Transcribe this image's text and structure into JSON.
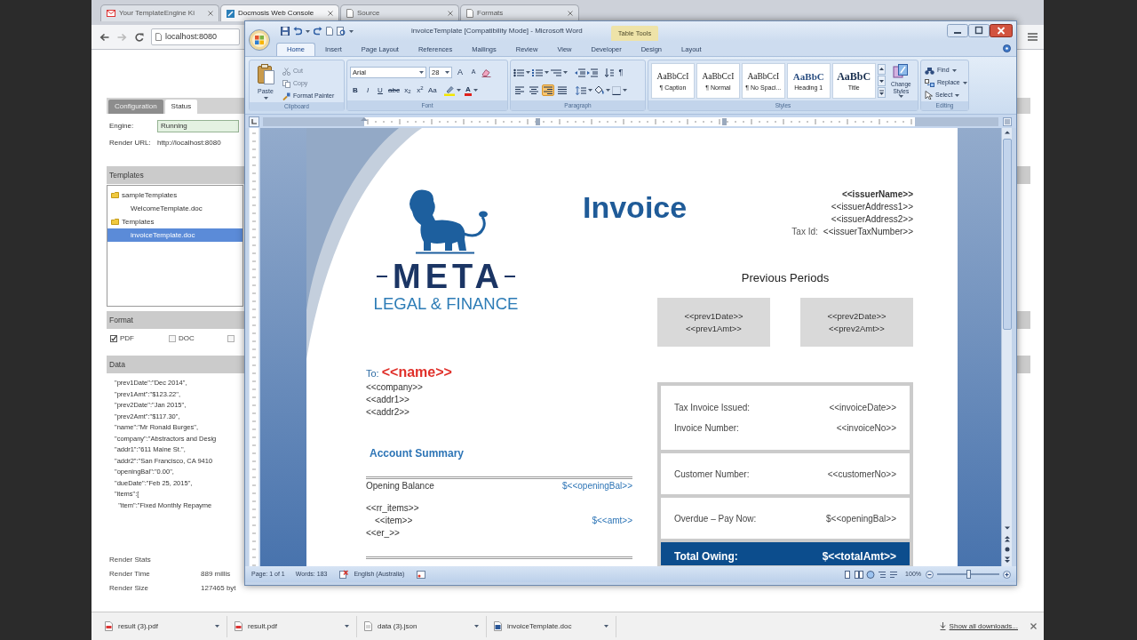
{
  "browser": {
    "tabs": [
      {
        "label": "Your TemplateEngine Ki",
        "kind": "mail",
        "selected": false
      },
      {
        "label": "Docmosis Web Console",
        "kind": "app",
        "selected": true
      },
      {
        "label": "Source",
        "kind": "page",
        "selected": false
      },
      {
        "label": "Formats",
        "kind": "page",
        "selected": false
      }
    ],
    "address": "localhost:8080"
  },
  "console": {
    "tabs": [
      {
        "label": "Configuration",
        "selected": false
      },
      {
        "label": "Status",
        "selected": true
      }
    ],
    "engine": {
      "label": "Engine:",
      "value": "Running"
    },
    "render_url": {
      "label": "Render URL:",
      "value": "http://localhost:8080"
    },
    "templates": {
      "title": "Templates",
      "tree": [
        {
          "label": "sampleTemplates",
          "kind": "folder",
          "selected": false,
          "children": [
            {
              "label": "WelcomeTemplate.doc",
              "kind": "file",
              "selected": false
            }
          ]
        },
        {
          "label": "Templates",
          "kind": "folder",
          "selected": false,
          "children": [
            {
              "label": "invoiceTemplate.doc",
              "kind": "file",
              "selected": true
            }
          ]
        }
      ]
    },
    "format": {
      "title": "Format",
      "options": [
        {
          "label": "PDF",
          "checked": true
        },
        {
          "label": "DOC",
          "checked": false
        },
        {
          "checked": false
        }
      ]
    },
    "data": {
      "title": "Data",
      "lines": [
        "\"prev1Date\":\"Dec 2014\",",
        "\"prev1Amt\":\"$123.22\",",
        "\"prev2Date\":\"Jan 2015\",",
        "\"prev2Amt\":\"$117.30\",",
        "\"name\":\"Mr Ronald Burges\",",
        "\"company\":\"Abstractors and Desig",
        "\"addr1\":\"611 Maine St.\",",
        "\"addr2\":\"San Francisco, CA 9410",
        "\"openingBal\":\"0.00\",",
        "\"dueDate\":\"Feb 25, 2015\",",
        "\"items\":[",
        "  \"item\":\"Fixed Monthly Repayme"
      ]
    },
    "stats": {
      "title": "Render Stats",
      "rows": [
        {
          "label": "Render Time",
          "value": "889 millis"
        },
        {
          "label": "Render Size",
          "value": "127465 byt"
        }
      ]
    }
  },
  "word": {
    "title": "invoiceTemplate [Compatibility Mode] - Microsoft Word",
    "contextual_tab": "Table Tools",
    "tabs": [
      {
        "label": "Home",
        "selected": true
      },
      {
        "label": "Insert",
        "selected": false
      },
      {
        "label": "Page Layout",
        "selected": false
      },
      {
        "label": "References",
        "selected": false
      },
      {
        "label": "Mailings",
        "selected": false
      },
      {
        "label": "Review",
        "selected": false
      },
      {
        "label": "View",
        "selected": false
      },
      {
        "label": "Developer",
        "selected": false
      },
      {
        "label": "Design",
        "selected": false
      },
      {
        "label": "Layout",
        "selected": false
      }
    ],
    "clipboard": {
      "title": "Clipboard",
      "paste": "Paste",
      "commands": [
        {
          "kind": "cut",
          "label": "Cut",
          "disabled": true
        },
        {
          "kind": "copy",
          "label": "Copy",
          "disabled": true
        },
        {
          "kind": "painter",
          "label": "Format Painter",
          "disabled": false
        }
      ]
    },
    "font": {
      "title": "Font",
      "face": "Arial",
      "size": "28",
      "size_buttons": [
        "A",
        "A"
      ],
      "style_buttons": [
        {
          "kind": "bold",
          "glyph": "B"
        },
        {
          "kind": "italic",
          "glyph": "I"
        },
        {
          "kind": "underline",
          "glyph": "U"
        },
        {
          "kind": "strike",
          "glyph": "abc"
        },
        {
          "kind": "plain",
          "glyph": "x$_{2}$"
        },
        {
          "kind": "plain",
          "glyph": "x$^{2}$"
        },
        {
          "kind": "plain",
          "glyph": "Aa"
        }
      ],
      "color_glyph": "A"
    },
    "paragraph": {
      "title": "Paragraph",
      "marks_glyph": "¶",
      "alignment": [
        {
          "kind": "left",
          "selected": false
        },
        {
          "kind": "center",
          "selected": false
        },
        {
          "kind": "right",
          "selected": true
        },
        {
          "kind": "justify",
          "selected": false
        }
      ]
    },
    "styles": {
      "title": "Styles",
      "gallery": [
        {
          "sample": "AaBbCcI",
          "name": "¶ Caption",
          "kind": "body",
          "selected": false
        },
        {
          "sample": "AaBbCcI",
          "name": "¶ Normal",
          "kind": "body",
          "selected": false
        },
        {
          "sample": "AaBbCcI",
          "name": "¶ No Spaci...",
          "kind": "body",
          "selected": false
        },
        {
          "sample": "AaBbC",
          "name": "Heading 1",
          "kind": "heading",
          "selected": false
        },
        {
          "sample": "AaBbC",
          "name": "Title",
          "kind": "title",
          "selected": false
        }
      ],
      "change_styles": "Change Styles"
    },
    "editing": {
      "title": "Editing",
      "commands": [
        {
          "kind": "find",
          "label": "Find"
        },
        {
          "kind": "replace",
          "label": "Replace"
        },
        {
          "kind": "select",
          "label": "Select"
        }
      ]
    },
    "document": {
      "logo": {
        "name": "META",
        "tagline": "LEGAL & FINANCE"
      },
      "title": "Invoice",
      "issuer": {
        "name": "<<issuerName>>",
        "address_lines": [
          "<<issuerAddress1>>",
          "<<issuerAddress2>>"
        ],
        "tax_label": "Tax Id:",
        "tax_value": "<<issuerTaxNumber>>"
      },
      "previous_periods": {
        "title": "Previous Periods",
        "periods": [
          {
            "date": "<<prev1Date>>",
            "amount": "<<prev1Amt>>"
          },
          {
            "date": "<<prev2Date>>",
            "amount": "<<prev2Amt>>"
          }
        ]
      },
      "recipient": {
        "to_label": "To:",
        "name": "<<name>>",
        "lines": [
          "<<company>>",
          "<<addr1>>",
          "<<addr2>>"
        ]
      },
      "account_summary": {
        "title": "Account Summary",
        "rows": [
          {
            "kind": "balance",
            "label": "Opening Balance",
            "value": "$<<openingBal>>"
          },
          {
            "kind": "marker",
            "label": "<<rr_items>>"
          },
          {
            "kind": "item",
            "label": "<<item>>",
            "value": "$<<amt>>"
          },
          {
            "kind": "marker",
            "label": "<<er_>>"
          }
        ]
      },
      "summary_panels": [
        {
          "kind": "plain",
          "rows": [
            {
              "label": "Tax Invoice Issued:",
              "value": "<<invoiceDate>>"
            },
            {
              "label": "Invoice Number:",
              "value": "<<invoiceNo>>"
            }
          ]
        },
        {
          "kind": "plain",
          "rows": [
            {
              "label": "Customer Number:",
              "value": "<<customerNo>>"
            }
          ]
        },
        {
          "kind": "plain",
          "rows": [
            {
              "label": "Overdue – Pay Now:",
              "value": "$<<openingBal>>"
            }
          ]
        },
        {
          "kind": "total",
          "rows": [
            {
              "label": "Total Owing:",
              "value": "$<<totalAmt>>"
            }
          ]
        }
      ]
    },
    "status_bar": {
      "page": "Page: 1 of 1",
      "words": "Words: 183",
      "language": "English (Australia)",
      "zoom": {
        "reading": "100%",
        "level": 0.5
      }
    }
  },
  "downloads": {
    "items": [
      {
        "kind": "pdf",
        "name": "result (3).pdf"
      },
      {
        "kind": "pdf",
        "name": "result.pdf"
      },
      {
        "kind": "json",
        "name": "data (3).json"
      },
      {
        "kind": "doc",
        "name": "invoiceTemplate.doc"
      }
    ],
    "show_all": "Show all downloads..."
  }
}
